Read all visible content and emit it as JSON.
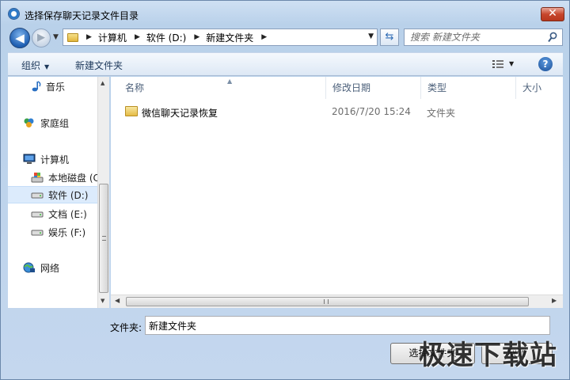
{
  "window": {
    "title": "选择保存聊天记录文件目录",
    "close_label": "✕"
  },
  "address": {
    "crumbs": [
      "计算机",
      "软件 (D:)",
      "新建文件夹"
    ]
  },
  "search": {
    "placeholder": "搜索 新建文件夹"
  },
  "toolbar": {
    "organize_label": "组织",
    "new_folder_label": "新建文件夹",
    "help_label": "?"
  },
  "sidebar": {
    "items": [
      {
        "label": "音乐",
        "icon": "music-icon"
      },
      {
        "label": "家庭组",
        "icon": "homegroup-icon"
      },
      {
        "label": "计算机",
        "icon": "computer-icon"
      },
      {
        "label": "本地磁盘 (C",
        "icon": "system-drive-icon"
      },
      {
        "label": "软件 (D:)",
        "icon": "drive-icon",
        "selected": true
      },
      {
        "label": "文档 (E:)",
        "icon": "drive-icon"
      },
      {
        "label": "娱乐 (F:)",
        "icon": "drive-icon"
      },
      {
        "label": "网络",
        "icon": "network-icon"
      }
    ]
  },
  "filelist": {
    "columns": [
      "名称",
      "修改日期",
      "类型",
      "大小"
    ],
    "rows": [
      {
        "name": "微信聊天记录恢复",
        "date": "2016/7/20 15:24",
        "type": "文件夹",
        "size": ""
      }
    ]
  },
  "footer": {
    "filename_label": "文件夹:",
    "filename_value": "新建文件夹",
    "select_button": "选择文件夹",
    "cancel_button": "取消"
  },
  "watermark": {
    "text": "极速下载站"
  },
  "colors": {
    "selection": "#dcebfc",
    "header_text": "#4c607a",
    "command_text": "#1e395b",
    "close_red": "#c7462c"
  }
}
